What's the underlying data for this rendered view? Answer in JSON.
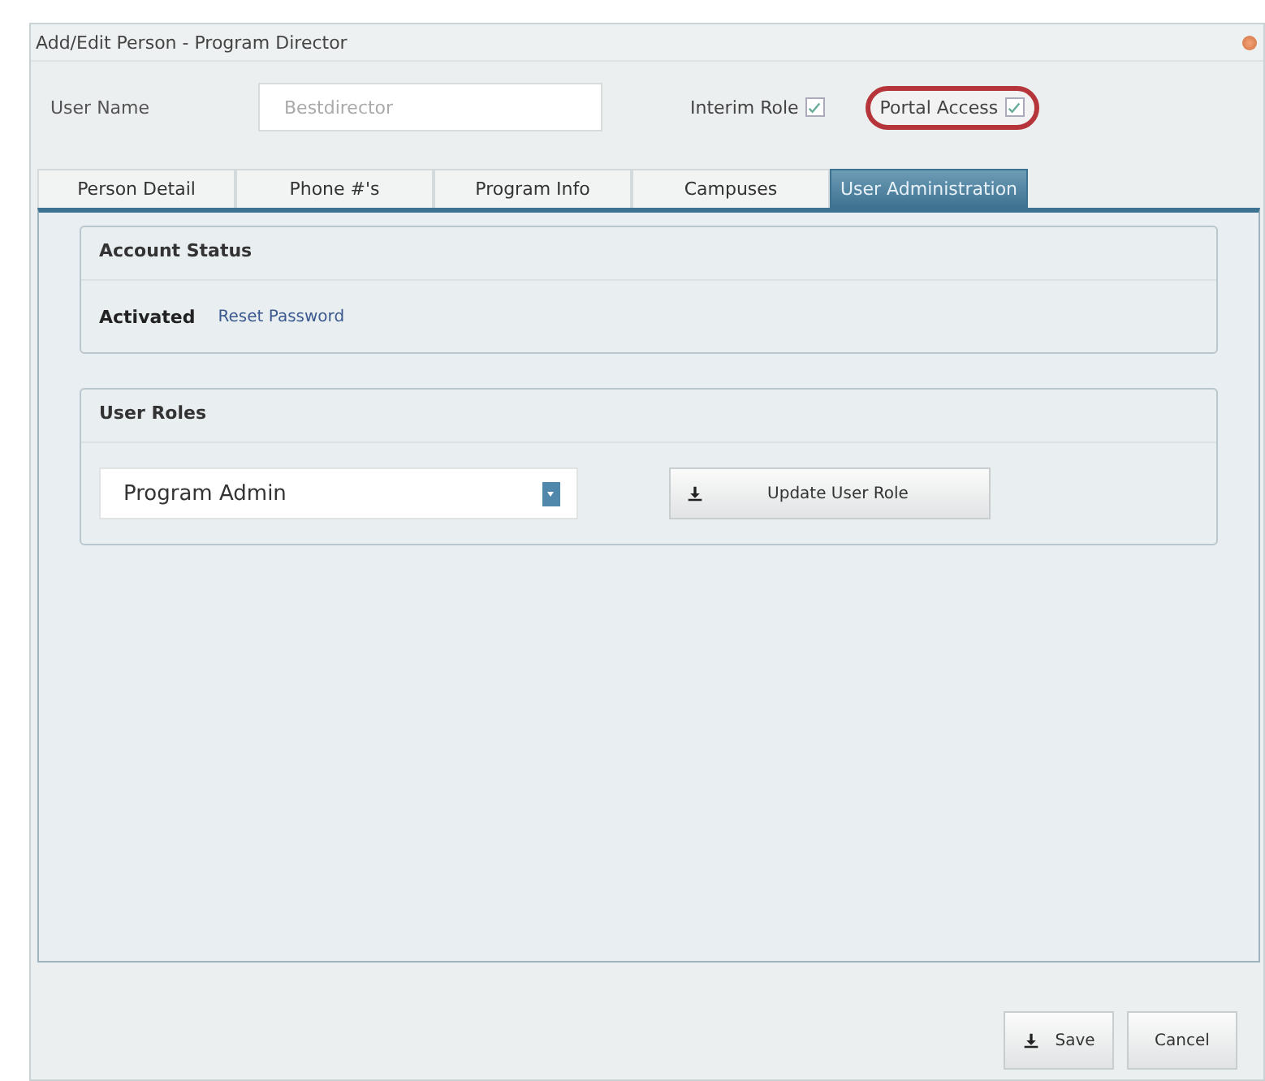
{
  "window": {
    "title": "Add/Edit Person - Program Director"
  },
  "user_name": {
    "label": "User Name",
    "placeholder": "Bestdirector"
  },
  "checkboxes": [
    {
      "label": "Interim Role",
      "checked": true,
      "highlighted": false
    },
    {
      "label": "Portal Access",
      "checked": true,
      "highlighted": true
    }
  ],
  "tabs": [
    {
      "label": "Person Detail",
      "selected": false
    },
    {
      "label": "Phone #'s",
      "selected": false
    },
    {
      "label": "Program Info",
      "selected": false
    },
    {
      "label": "Campuses",
      "selected": false
    },
    {
      "label": "User Administration",
      "selected": true
    }
  ],
  "account_status": {
    "title": "Account Status",
    "status": "Activated",
    "link": "Reset Password"
  },
  "user_roles": {
    "title": "User Roles",
    "role": "Program Admin",
    "button": "Update User Role"
  },
  "buttons": [
    {
      "label": "Save",
      "kind": "icon"
    },
    {
      "label": "Cancel",
      "kind": "plain"
    }
  ]
}
